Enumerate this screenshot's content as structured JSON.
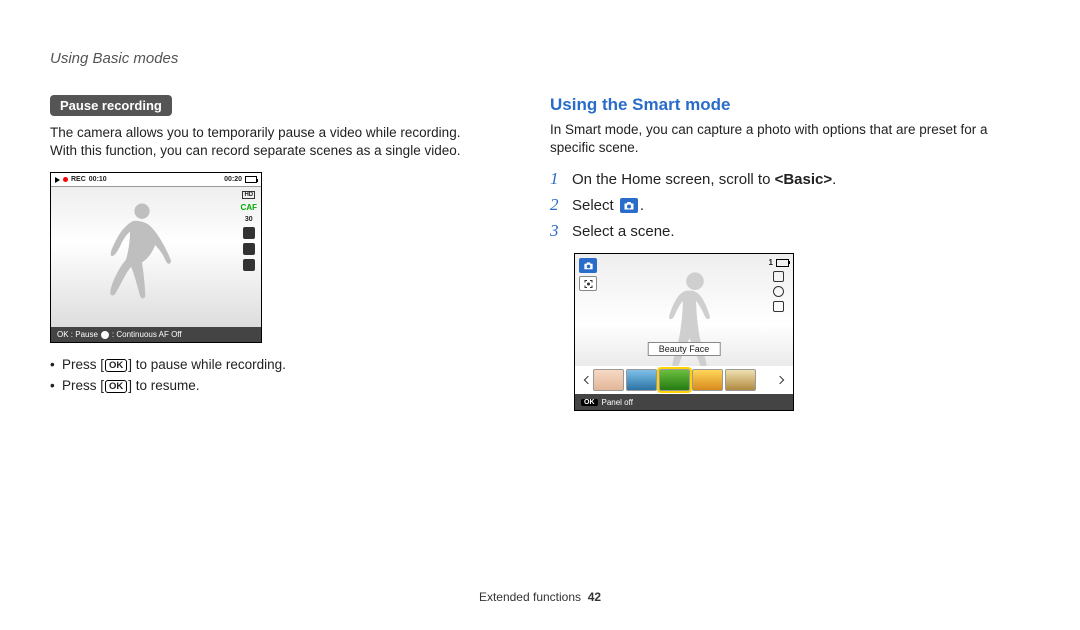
{
  "header": "Using Basic modes",
  "left": {
    "pill": "Pause recording",
    "desc": "The camera allows you to temporarily pause a video while recording. With this function, you can record separate scenes as a single video.",
    "screenshot": {
      "rec": "REC",
      "time_elapsed": "00:10",
      "time_total": "00:20",
      "hd": "HD",
      "caf": "CAF",
      "fps": "30",
      "footer_ok": "OK : Pause",
      "footer_caf": ": Continuous AF Off"
    },
    "bullet1_a": "Press [",
    "bullet1_b": "] to pause while recording.",
    "bullet2_a": "Press [",
    "bullet2_b": "] to resume.",
    "ok_label": "OK"
  },
  "right": {
    "heading": "Using the Smart mode",
    "desc": "In Smart mode, you can capture a photo with options that are preset for a specific scene.",
    "steps": {
      "s1_num": "1",
      "s1_a": "On the Home screen, scroll to ",
      "s1_b": "<Basic>",
      "s1_c": ".",
      "s2_num": "2",
      "s2_a": "Select ",
      "s2_b": ".",
      "s3_num": "3",
      "s3": "Select a scene."
    },
    "screenshot": {
      "bat_count": "1",
      "label": "Beauty Face",
      "footer": "Panel off",
      "ok": "OK"
    }
  },
  "footer": {
    "section": "Extended functions",
    "page": "42"
  }
}
